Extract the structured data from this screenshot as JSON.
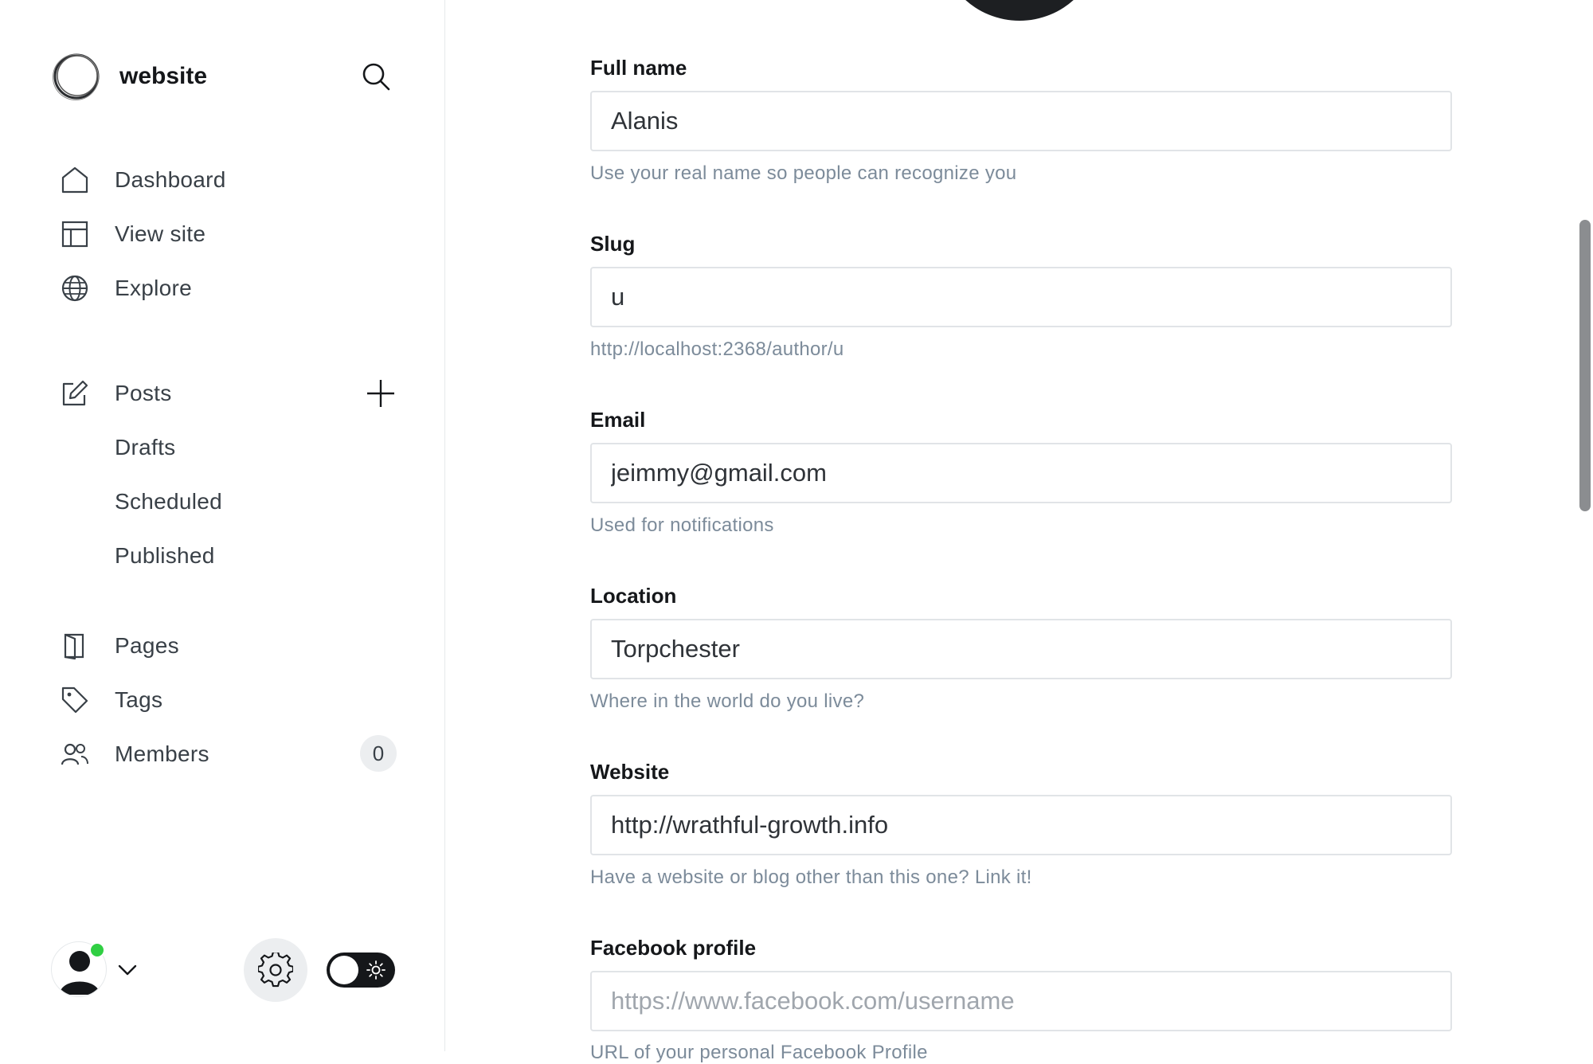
{
  "sidebar": {
    "brand_name": "website",
    "nav_primary": [
      {
        "label": "Dashboard",
        "icon": "home-icon"
      },
      {
        "label": "View site",
        "icon": "layout-icon"
      },
      {
        "label": "Explore",
        "icon": "globe-icon"
      }
    ],
    "posts": {
      "label": "Posts",
      "icon": "edit-icon",
      "sub_items": [
        "Drafts",
        "Scheduled",
        "Published"
      ]
    },
    "nav_secondary": [
      {
        "label": "Pages",
        "icon": "page-icon"
      },
      {
        "label": "Tags",
        "icon": "tag-icon"
      },
      {
        "label": "Members",
        "icon": "members-icon",
        "count": "0"
      }
    ],
    "status_color": "#30cf43"
  },
  "form": {
    "fields": [
      {
        "label": "Full name",
        "value": "Alanis",
        "placeholder": "",
        "help": "Use your real name so people can recognize you"
      },
      {
        "label": "Slug",
        "value": "u",
        "placeholder": "",
        "help": "http://localhost:2368/author/u"
      },
      {
        "label": "Email",
        "value": "jeimmy@gmail.com",
        "placeholder": "",
        "help": "Used for notifications"
      },
      {
        "label": "Location",
        "value": "Torpchester",
        "placeholder": "",
        "help": "Where in the world do you live?"
      },
      {
        "label": "Website",
        "value": "http://wrathful-growth.info",
        "placeholder": "",
        "help": "Have a website or blog other than this one? Link it!"
      },
      {
        "label": "Facebook profile",
        "value": "",
        "placeholder": "https://www.facebook.com/username",
        "help": "URL of your personal Facebook Profile"
      }
    ]
  },
  "theme": {
    "accent": "#15171a",
    "muted_text": "#7c8b9a",
    "border": "#e1e4e7"
  }
}
